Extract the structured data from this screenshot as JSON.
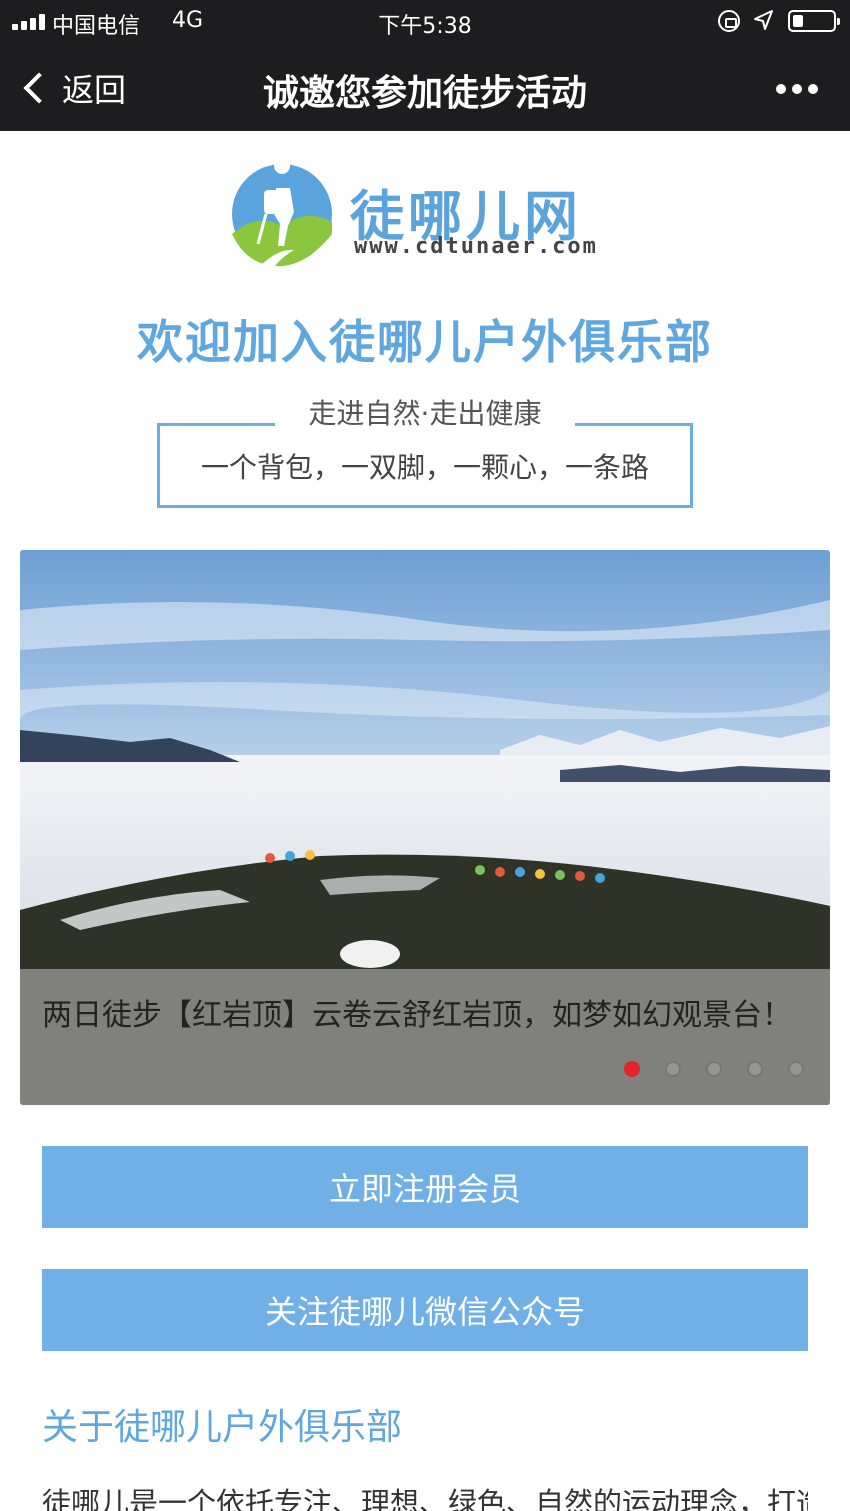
{
  "status_bar": {
    "carrier": "中国电信",
    "network": "4G",
    "time": "下午5:38"
  },
  "nav": {
    "back_label": "返回",
    "title": "诚邀您参加徒步活动"
  },
  "logo": {
    "name": "徒哪儿网",
    "url": "www.cdtunaer.com"
  },
  "welcome": "欢迎加入徒哪儿户外俱乐部",
  "slogan": {
    "top": "走进自然·走出健康",
    "bottom": "一个背包，一双脚，一颗心，一条路"
  },
  "carousel": {
    "caption": "两日徒步【红岩顶】云卷云舒红岩顶，如梦如幻观景台！",
    "slide_count": 5,
    "active_index": 0
  },
  "buttons": {
    "register": "立即注册会员",
    "follow": "关注徒哪儿微信公众号"
  },
  "about": {
    "heading": "关于徒哪儿户外俱乐部",
    "text": "徒哪儿是一个依托专注、理想、绿色、自然的运动理念，打造专"
  },
  "colors": {
    "accent": "#5fa7de",
    "button": "#71b0e6",
    "active_dot": "#e8232a",
    "topbar": "#1d1d1f"
  }
}
